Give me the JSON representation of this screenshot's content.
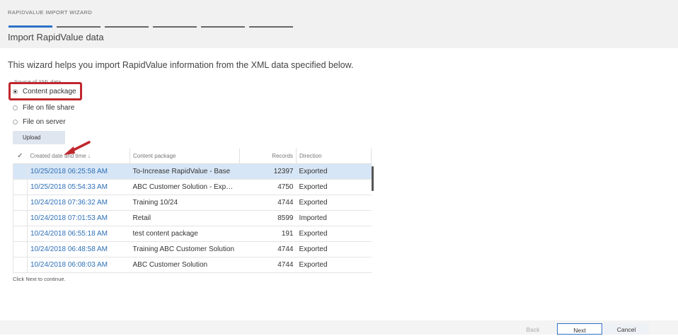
{
  "wizard": {
    "title": "RAPIDVALUE IMPORT WIZARD",
    "page_title": "Import RapidValue data",
    "intro": "This wizard helps you import RapidValue information from the XML data specified below."
  },
  "source": {
    "label": "Source of XML data",
    "options": [
      "Content package",
      "File on file share",
      "File on server"
    ],
    "selected": "Content package"
  },
  "upload_label": "Upload",
  "table": {
    "columns": [
      "Created date and time ↓",
      "Content package",
      "Records",
      "Direction"
    ],
    "check_header": "✓",
    "rows": [
      {
        "date": "10/25/2018 06:25:58 AM",
        "package": "To-Increase RapidValue - Base",
        "records": "12397",
        "direction": "Exported"
      },
      {
        "date": "10/25/2018 05:54:33 AM",
        "package": "ABC Customer Solution - Export...",
        "records": "4750",
        "direction": "Exported"
      },
      {
        "date": "10/24/2018 07:36:32 AM",
        "package": "Training 10/24",
        "records": "4744",
        "direction": "Exported"
      },
      {
        "date": "10/24/2018 07:01:53 AM",
        "package": "Retail",
        "records": "8599",
        "direction": "Imported"
      },
      {
        "date": "10/24/2018 06:55:18 AM",
        "package": "test content package",
        "records": "191",
        "direction": "Exported"
      },
      {
        "date": "10/24/2018 06:48:58 AM",
        "package": "Training ABC Customer Solution",
        "records": "4744",
        "direction": "Exported"
      },
      {
        "date": "10/24/2018 06:08:03 AM",
        "package": "ABC Customer Solution",
        "records": "4744",
        "direction": "Exported"
      }
    ]
  },
  "footer_note": "Click Next to continue.",
  "buttons": {
    "back": "Back",
    "next": "Next",
    "cancel": "Cancel"
  },
  "colors": {
    "accent": "#2d72c7",
    "highlight": "#c0272d",
    "link": "#2d6fb7",
    "selected_row": "#d7e6f6"
  }
}
